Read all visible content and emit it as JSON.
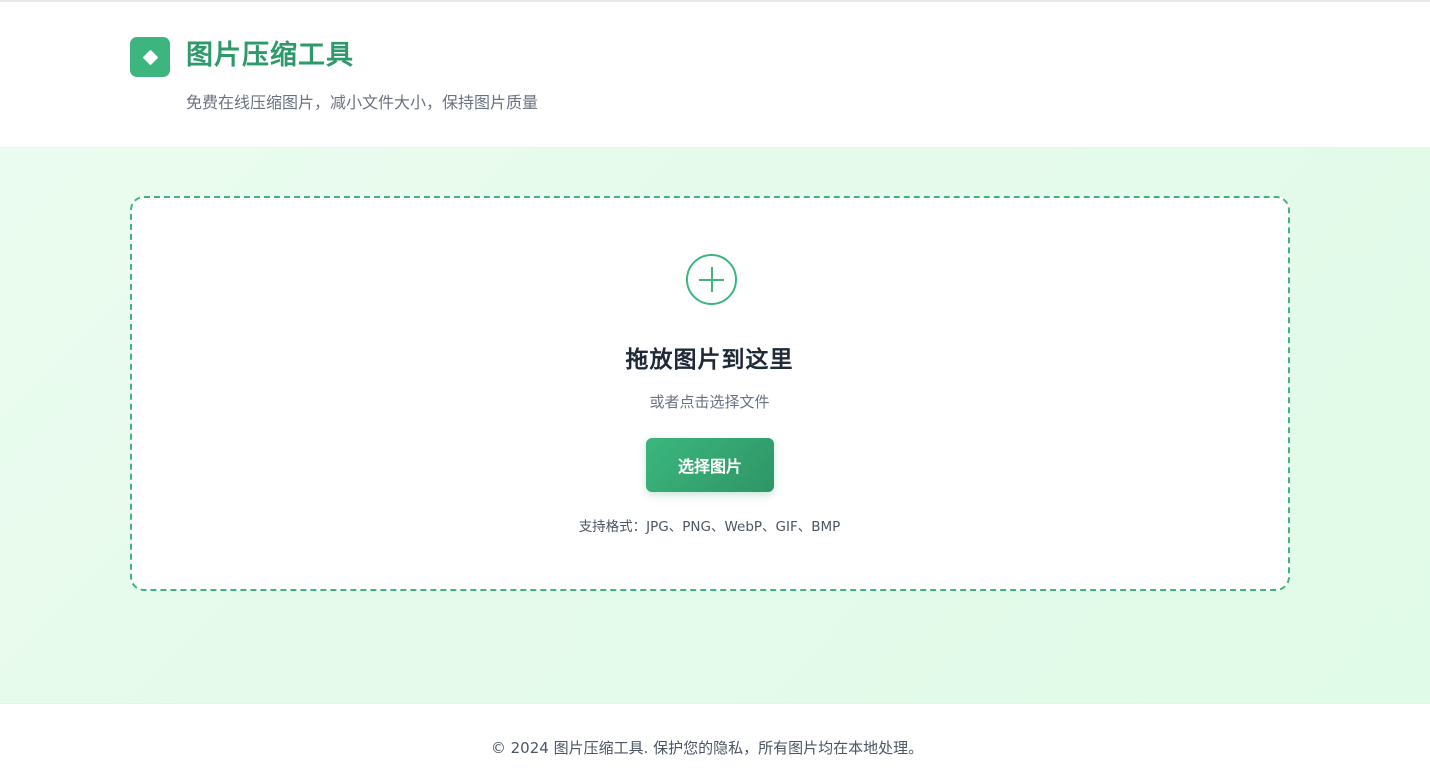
{
  "header": {
    "logo_icon": "diamond-icon",
    "title": "图片压缩工具",
    "subtitle": "免费在线压缩图片，减小文件大小，保持图片质量"
  },
  "upload": {
    "icon": "plus-circle-icon",
    "title": "拖放图片到这里",
    "hint": "或者点击选择文件",
    "button_label": "选择图片",
    "formats": "支持格式：JPG、PNG、WebP、GIF、BMP"
  },
  "footer": {
    "text": "© 2024 图片压缩工具. 保护您的隐私，所有图片均在本地处理。"
  },
  "colors": {
    "accent": "#3db57f",
    "title_green": "#2e9a6a",
    "background_mint": "#e5faeb"
  }
}
